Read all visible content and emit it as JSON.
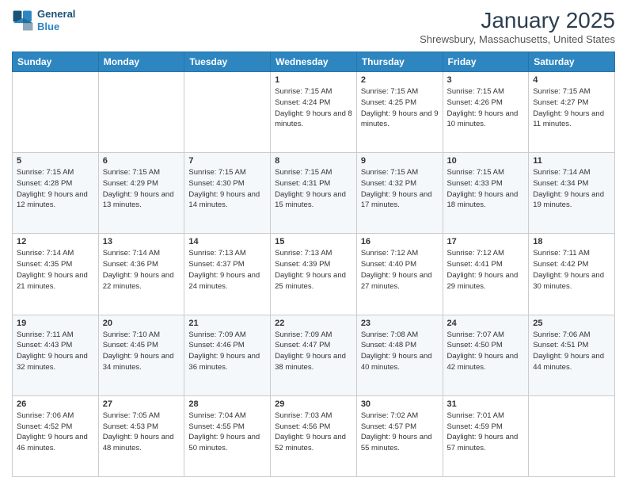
{
  "header": {
    "logo_line1": "General",
    "logo_line2": "Blue",
    "month_title": "January 2025",
    "location": "Shrewsbury, Massachusetts, United States"
  },
  "weekdays": [
    "Sunday",
    "Monday",
    "Tuesday",
    "Wednesday",
    "Thursday",
    "Friday",
    "Saturday"
  ],
  "weeks": [
    [
      {
        "day": "",
        "info": ""
      },
      {
        "day": "",
        "info": ""
      },
      {
        "day": "",
        "info": ""
      },
      {
        "day": "1",
        "info": "Sunrise: 7:15 AM\nSunset: 4:24 PM\nDaylight: 9 hours\nand 8 minutes."
      },
      {
        "day": "2",
        "info": "Sunrise: 7:15 AM\nSunset: 4:25 PM\nDaylight: 9 hours\nand 9 minutes."
      },
      {
        "day": "3",
        "info": "Sunrise: 7:15 AM\nSunset: 4:26 PM\nDaylight: 9 hours\nand 10 minutes."
      },
      {
        "day": "4",
        "info": "Sunrise: 7:15 AM\nSunset: 4:27 PM\nDaylight: 9 hours\nand 11 minutes."
      }
    ],
    [
      {
        "day": "5",
        "info": "Sunrise: 7:15 AM\nSunset: 4:28 PM\nDaylight: 9 hours\nand 12 minutes."
      },
      {
        "day": "6",
        "info": "Sunrise: 7:15 AM\nSunset: 4:29 PM\nDaylight: 9 hours\nand 13 minutes."
      },
      {
        "day": "7",
        "info": "Sunrise: 7:15 AM\nSunset: 4:30 PM\nDaylight: 9 hours\nand 14 minutes."
      },
      {
        "day": "8",
        "info": "Sunrise: 7:15 AM\nSunset: 4:31 PM\nDaylight: 9 hours\nand 15 minutes."
      },
      {
        "day": "9",
        "info": "Sunrise: 7:15 AM\nSunset: 4:32 PM\nDaylight: 9 hours\nand 17 minutes."
      },
      {
        "day": "10",
        "info": "Sunrise: 7:15 AM\nSunset: 4:33 PM\nDaylight: 9 hours\nand 18 minutes."
      },
      {
        "day": "11",
        "info": "Sunrise: 7:14 AM\nSunset: 4:34 PM\nDaylight: 9 hours\nand 19 minutes."
      }
    ],
    [
      {
        "day": "12",
        "info": "Sunrise: 7:14 AM\nSunset: 4:35 PM\nDaylight: 9 hours\nand 21 minutes."
      },
      {
        "day": "13",
        "info": "Sunrise: 7:14 AM\nSunset: 4:36 PM\nDaylight: 9 hours\nand 22 minutes."
      },
      {
        "day": "14",
        "info": "Sunrise: 7:13 AM\nSunset: 4:37 PM\nDaylight: 9 hours\nand 24 minutes."
      },
      {
        "day": "15",
        "info": "Sunrise: 7:13 AM\nSunset: 4:39 PM\nDaylight: 9 hours\nand 25 minutes."
      },
      {
        "day": "16",
        "info": "Sunrise: 7:12 AM\nSunset: 4:40 PM\nDaylight: 9 hours\nand 27 minutes."
      },
      {
        "day": "17",
        "info": "Sunrise: 7:12 AM\nSunset: 4:41 PM\nDaylight: 9 hours\nand 29 minutes."
      },
      {
        "day": "18",
        "info": "Sunrise: 7:11 AM\nSunset: 4:42 PM\nDaylight: 9 hours\nand 30 minutes."
      }
    ],
    [
      {
        "day": "19",
        "info": "Sunrise: 7:11 AM\nSunset: 4:43 PM\nDaylight: 9 hours\nand 32 minutes."
      },
      {
        "day": "20",
        "info": "Sunrise: 7:10 AM\nSunset: 4:45 PM\nDaylight: 9 hours\nand 34 minutes."
      },
      {
        "day": "21",
        "info": "Sunrise: 7:09 AM\nSunset: 4:46 PM\nDaylight: 9 hours\nand 36 minutes."
      },
      {
        "day": "22",
        "info": "Sunrise: 7:09 AM\nSunset: 4:47 PM\nDaylight: 9 hours\nand 38 minutes."
      },
      {
        "day": "23",
        "info": "Sunrise: 7:08 AM\nSunset: 4:48 PM\nDaylight: 9 hours\nand 40 minutes."
      },
      {
        "day": "24",
        "info": "Sunrise: 7:07 AM\nSunset: 4:50 PM\nDaylight: 9 hours\nand 42 minutes."
      },
      {
        "day": "25",
        "info": "Sunrise: 7:06 AM\nSunset: 4:51 PM\nDaylight: 9 hours\nand 44 minutes."
      }
    ],
    [
      {
        "day": "26",
        "info": "Sunrise: 7:06 AM\nSunset: 4:52 PM\nDaylight: 9 hours\nand 46 minutes."
      },
      {
        "day": "27",
        "info": "Sunrise: 7:05 AM\nSunset: 4:53 PM\nDaylight: 9 hours\nand 48 minutes."
      },
      {
        "day": "28",
        "info": "Sunrise: 7:04 AM\nSunset: 4:55 PM\nDaylight: 9 hours\nand 50 minutes."
      },
      {
        "day": "29",
        "info": "Sunrise: 7:03 AM\nSunset: 4:56 PM\nDaylight: 9 hours\nand 52 minutes."
      },
      {
        "day": "30",
        "info": "Sunrise: 7:02 AM\nSunset: 4:57 PM\nDaylight: 9 hours\nand 55 minutes."
      },
      {
        "day": "31",
        "info": "Sunrise: 7:01 AM\nSunset: 4:59 PM\nDaylight: 9 hours\nand 57 minutes."
      },
      {
        "day": "",
        "info": ""
      }
    ]
  ]
}
